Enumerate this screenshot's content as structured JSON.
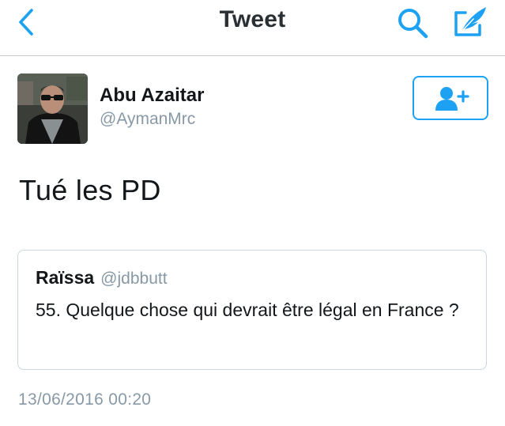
{
  "navbar": {
    "title": "Tweet",
    "back_icon": "chevron-left-icon",
    "search_icon": "search-icon",
    "compose_icon": "compose-quill-icon"
  },
  "author": {
    "name": "Abu Azaitar",
    "handle": "@AymanMrc",
    "follow_icon": "add-user-icon"
  },
  "tweet": {
    "text": "Tué les PD",
    "timestamp": "13/06/2016 00:20"
  },
  "quoted_tweet": {
    "name": "Raïssa",
    "handle": "@jdbbutt",
    "text": "55. Quelque chose qui devrait être légal en France ?"
  },
  "colors": {
    "accent": "#1da1f2",
    "secondary_text": "#8899a6",
    "primary_text": "#14171a"
  }
}
